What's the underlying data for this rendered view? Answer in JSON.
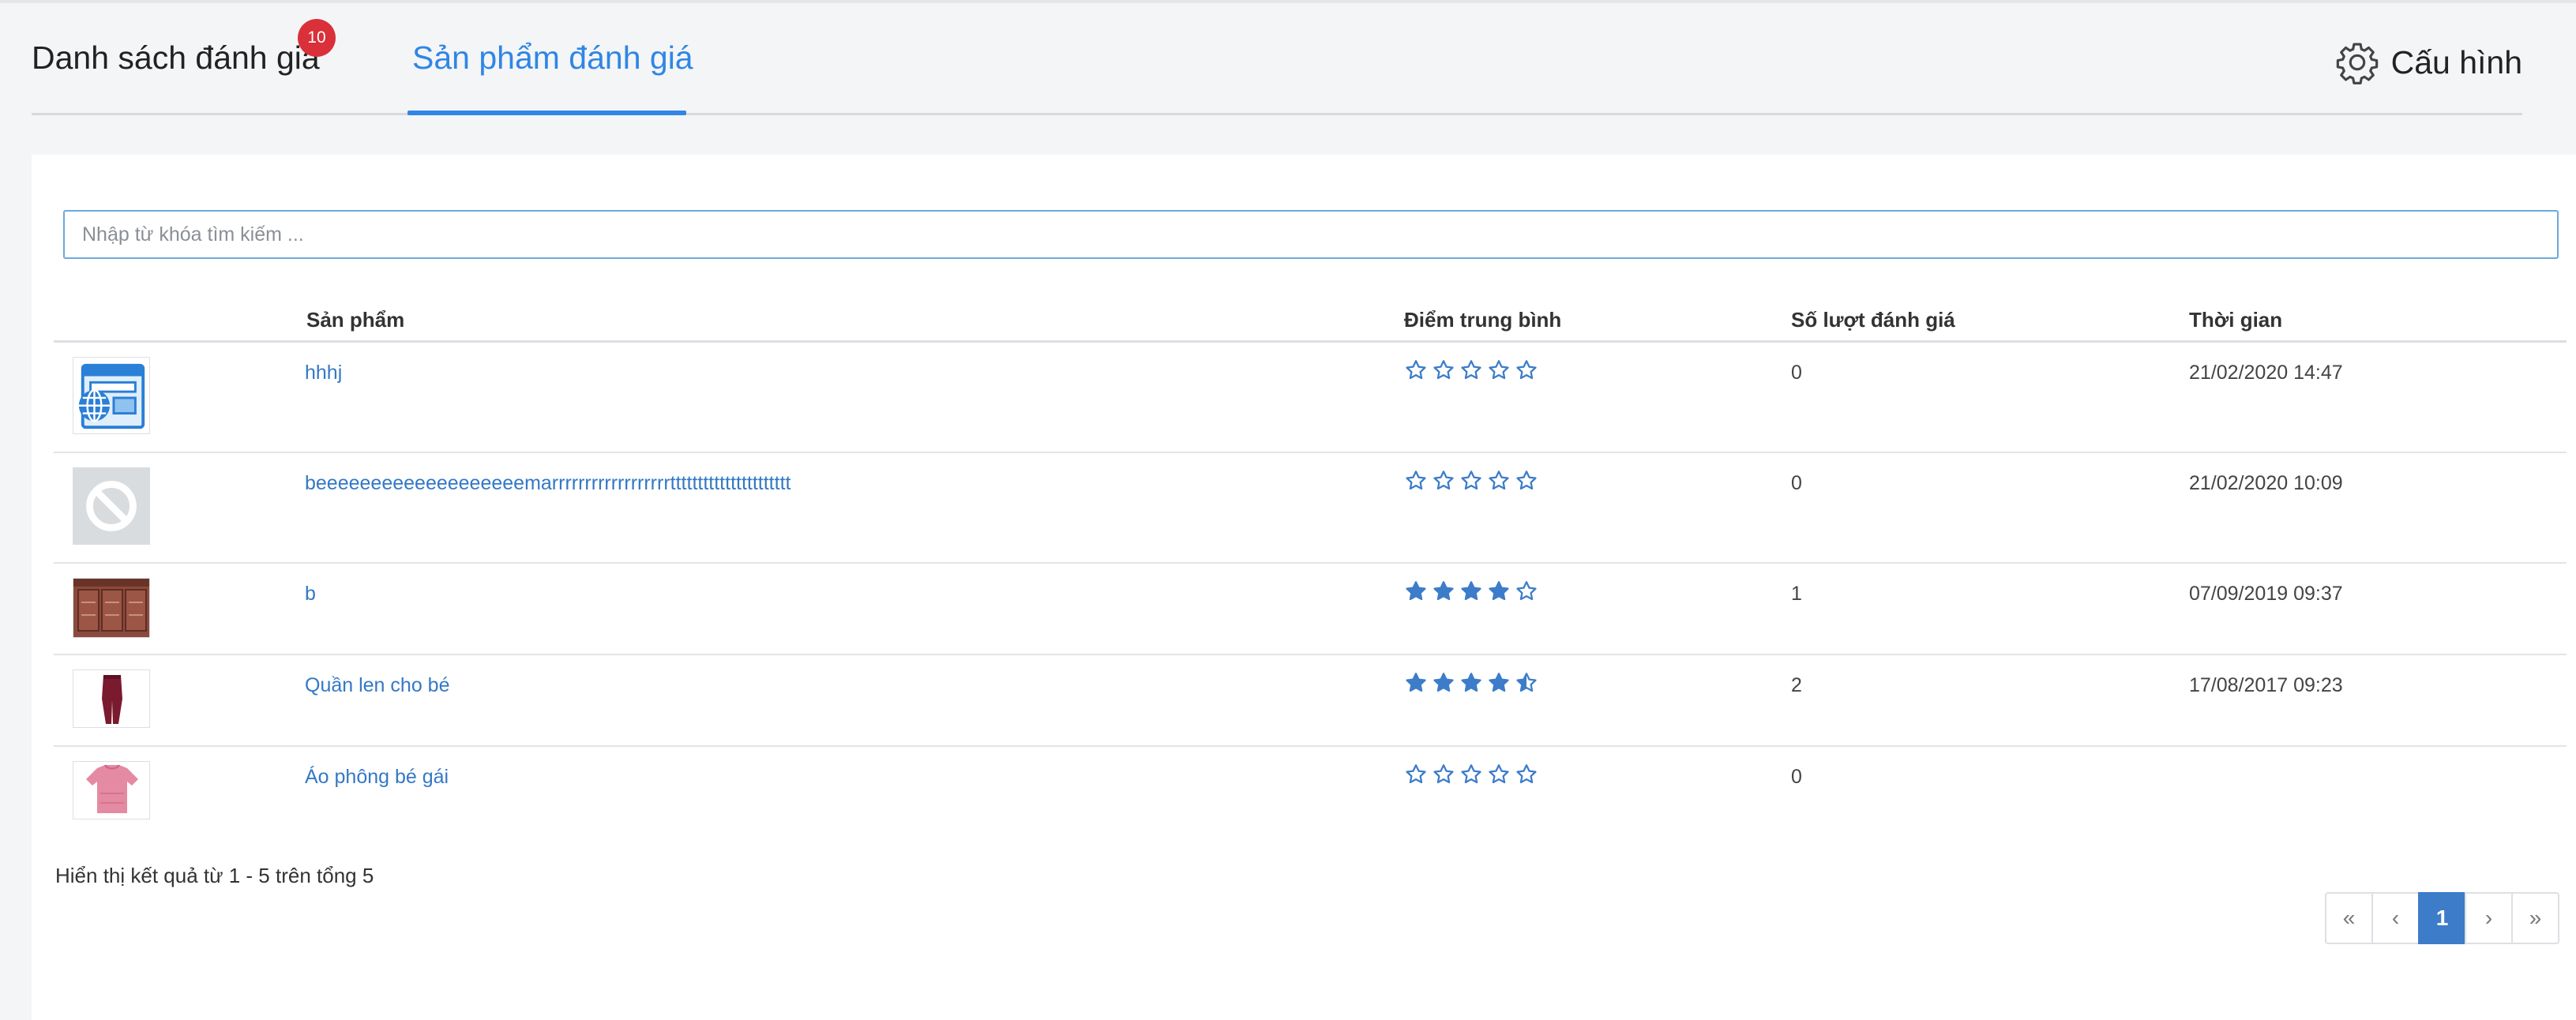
{
  "tabs": {
    "reviews_label": "Danh sách đánh giá",
    "reviews_badge": "10",
    "products_label": "Sản phẩm đánh giá"
  },
  "config": {
    "label": "Cấu hình",
    "icon": "gear-icon"
  },
  "search": {
    "placeholder": "Nhập từ khóa tìm kiếm ...",
    "value": ""
  },
  "table": {
    "headers": {
      "product": "Sản phẩm",
      "rating": "Điểm trung bình",
      "count": "Số lượt đánh giá",
      "time": "Thời gian"
    },
    "rows": [
      {
        "name": "hhhj",
        "rating": 0,
        "count": "0",
        "time": "21/02/2020 14:47",
        "thumb": "web-browser-globe-icon"
      },
      {
        "name": "beeeeeeeeeeeeeeeeeeemarrrrrrrrrrrrrrrrrrtttttttttttttttttttttt",
        "rating": 0,
        "count": "0",
        "time": "21/02/2020 10:09",
        "thumb": "no-image-icon"
      },
      {
        "name": "b",
        "rating": 4,
        "count": "1",
        "time": "07/09/2019 09:37",
        "thumb": "brown-cabinet-photo"
      },
      {
        "name": "Quần len cho bé",
        "rating": 4.5,
        "count": "2",
        "time": "17/08/2017 09:23",
        "thumb": "maroon-pants-photo"
      },
      {
        "name": "Áo phông bé gái",
        "rating": 0,
        "count": "0",
        "time": "",
        "thumb": "pink-shirt-photo"
      }
    ]
  },
  "summary": "Hiển thị kết quả từ 1 - 5 trên tổng 5",
  "pagination": {
    "first": "«",
    "prev": "‹",
    "current": "1",
    "next": "›",
    "last": "»"
  },
  "colors": {
    "accent": "#2f86e5",
    "star": "#3d7cc9",
    "badge": "#d9303a",
    "link": "#3478c6"
  }
}
